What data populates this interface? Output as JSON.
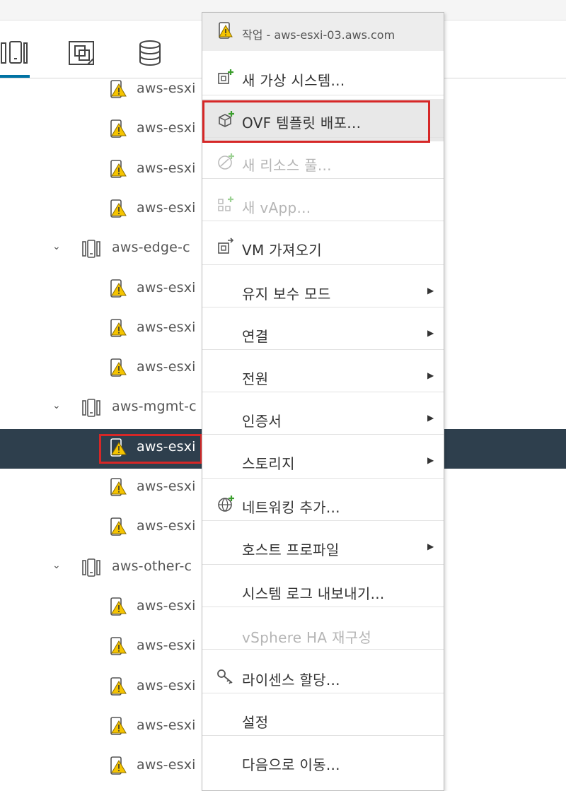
{
  "top_tabs": [
    {
      "icon": "hosts-clusters-icon",
      "active": true
    },
    {
      "icon": "vms-templates-icon",
      "active": false
    },
    {
      "icon": "storage-icon",
      "active": false
    }
  ],
  "tree": [
    {
      "label": "aws-esxi",
      "type": "host-warning"
    },
    {
      "label": "aws-esxi",
      "type": "host-warning"
    },
    {
      "label": "aws-esxi",
      "type": "host-warning"
    },
    {
      "label": "aws-esxi",
      "type": "host-warning"
    },
    {
      "label": "aws-edge-c",
      "type": "cluster"
    },
    {
      "label": "aws-esxi",
      "type": "host-warning"
    },
    {
      "label": "aws-esxi",
      "type": "host-warning"
    },
    {
      "label": "aws-esxi",
      "type": "host-warning"
    },
    {
      "label": "aws-mgmt-c",
      "type": "cluster"
    },
    {
      "label": "aws-esxi",
      "type": "host-warning",
      "selected": true
    },
    {
      "label": "aws-esxi",
      "type": "host-warning"
    },
    {
      "label": "aws-esxi",
      "type": "host-warning"
    },
    {
      "label": "aws-other-c",
      "type": "cluster"
    },
    {
      "label": "aws-esxi",
      "type": "host-warning"
    },
    {
      "label": "aws-esxi",
      "type": "host-warning"
    },
    {
      "label": "aws-esxi",
      "type": "host-warning"
    },
    {
      "label": "aws-esxi",
      "type": "host-warning"
    },
    {
      "label": "aws-esxi",
      "type": "host-warning"
    }
  ],
  "menu": {
    "header": "작업 - aws-esxi-03.aws.com",
    "items": [
      {
        "label": "새 가상 시스템...",
        "icon": "new-vm-icon",
        "enabled": true
      },
      {
        "label": "OVF 템플릿 배포...",
        "icon": "deploy-ovf-icon",
        "enabled": true,
        "highlighted": true
      },
      {
        "label": "새 리소스 풀...",
        "icon": "new-resource-pool-icon",
        "enabled": false
      },
      {
        "label": "새 vApp...",
        "icon": "new-vapp-icon",
        "enabled": false
      },
      {
        "label": "VM 가져오기",
        "icon": "import-vm-icon",
        "enabled": true
      },
      {
        "label": "유지 보수 모드",
        "submenu": true,
        "enabled": true
      },
      {
        "label": "연결",
        "submenu": true,
        "enabled": true
      },
      {
        "label": "전원",
        "submenu": true,
        "enabled": true
      },
      {
        "label": "인증서",
        "submenu": true,
        "enabled": true
      },
      {
        "label": "스토리지",
        "submenu": true,
        "enabled": true
      },
      {
        "label": "네트워킹 추가...",
        "icon": "add-networking-icon",
        "enabled": true
      },
      {
        "label": "호스트 프로파일",
        "submenu": true,
        "enabled": true
      },
      {
        "label": "시스템 로그 내보내기...",
        "enabled": true
      },
      {
        "label": "vSphere HA 재구성",
        "enabled": false
      },
      {
        "label": "라이센스 할당...",
        "icon": "license-key-icon",
        "enabled": true
      },
      {
        "label": "설정",
        "enabled": true
      },
      {
        "label": "다음으로 이동...",
        "enabled": true
      }
    ]
  },
  "colors": {
    "selection_bg": "#2e3f4d",
    "annotation_red": "#d62727",
    "warning_yellow": "#f5c400",
    "add_green": "#3a9d2c",
    "tab_accent": "#0072a3"
  }
}
